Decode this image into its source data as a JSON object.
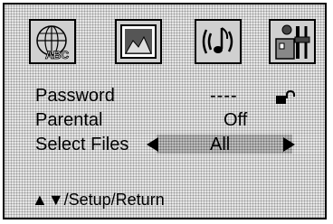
{
  "menu": {
    "icons": [
      {
        "name": "language-icon",
        "label": "ABC"
      },
      {
        "name": "picture-icon"
      },
      {
        "name": "audio-icon"
      },
      {
        "name": "setup-icon"
      }
    ]
  },
  "settings": {
    "password": {
      "label": "Password",
      "value": "----"
    },
    "parental": {
      "label": "Parental",
      "value": "Off"
    },
    "select_files": {
      "label": "Select Files",
      "value": "All"
    }
  },
  "hint": {
    "text": "▲▼/Setup/Return"
  }
}
